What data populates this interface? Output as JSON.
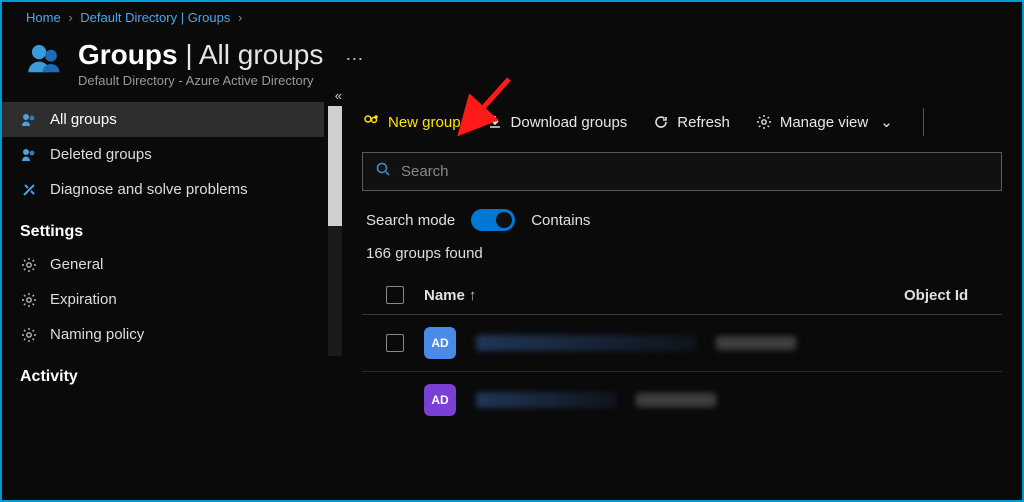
{
  "breadcrumb": {
    "home": "Home",
    "middle": "Default Directory | Groups"
  },
  "header": {
    "title_strong": "Groups",
    "title_light": "All groups",
    "subtitle": "Default Directory - Azure Active Directory"
  },
  "sidebar": {
    "items": [
      {
        "icon": "people-icon",
        "label": "All groups",
        "active": true
      },
      {
        "icon": "people-icon",
        "label": "Deleted groups",
        "active": false
      },
      {
        "icon": "tools-icon",
        "label": "Diagnose and solve problems",
        "active": false
      }
    ],
    "section_settings": "Settings",
    "settings": [
      {
        "icon": "gear-icon",
        "label": "General"
      },
      {
        "icon": "gear-icon",
        "label": "Expiration"
      },
      {
        "icon": "gear-icon",
        "label": "Naming policy"
      }
    ],
    "section_activity": "Activity"
  },
  "toolbar": {
    "new_group": "New group",
    "download": "Download groups",
    "refresh": "Refresh",
    "manage_view": "Manage view"
  },
  "search": {
    "placeholder": "Search",
    "mode_label": "Search mode",
    "mode_value": "Contains"
  },
  "results": {
    "count_text": "166 groups found"
  },
  "table": {
    "col_name": "Name",
    "col_object": "Object Id",
    "rows": [
      {
        "avatar": "AD",
        "avatar_color": "blue"
      },
      {
        "avatar": "AD",
        "avatar_color": "purple"
      }
    ]
  }
}
